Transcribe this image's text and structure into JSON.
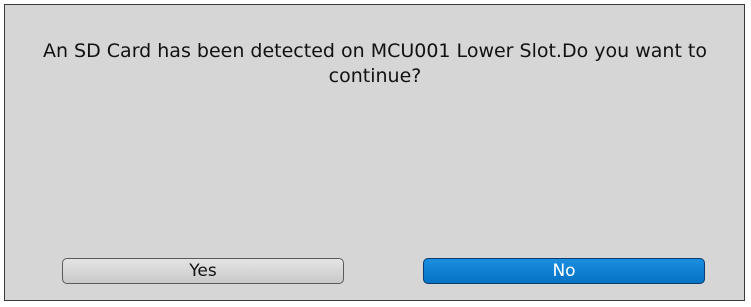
{
  "dialog": {
    "message": "An SD Card has been detected on  MCU001 Lower Slot.Do you want to continue?",
    "yes_label": "Yes",
    "no_label": "No",
    "colors": {
      "background": "#d6d6d6",
      "selected_button": "#0a7fd6",
      "unselected_button": "#d4d4d4"
    }
  }
}
